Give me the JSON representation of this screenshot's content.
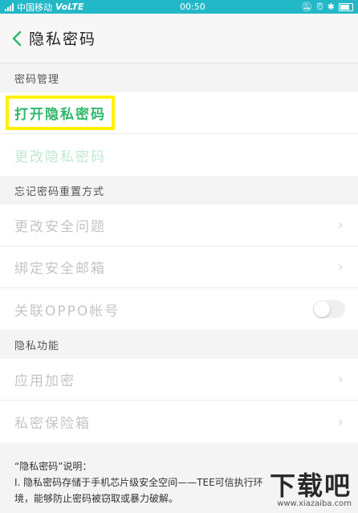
{
  "status_bar": {
    "carrier": "中国移动",
    "network": "VoLTE",
    "time": "00:50"
  },
  "header": {
    "title": "隐私密码"
  },
  "sections": [
    {
      "title": "密码管理",
      "items": [
        {
          "label": "打开隐私密码",
          "state": "active"
        },
        {
          "label": "更改隐私密码",
          "state": "disabled"
        }
      ]
    },
    {
      "title": "忘记密码重置方式",
      "items": [
        {
          "label": "更改安全问题"
        },
        {
          "label": "绑定安全邮箱"
        },
        {
          "label": "关联OPPO帐号"
        }
      ]
    },
    {
      "title": "隐私功能",
      "items": [
        {
          "label": "应用加密"
        },
        {
          "label": "私密保险箱"
        }
      ]
    }
  ],
  "notes": {
    "title": "“隐私密码”说明：",
    "line1": "Ⅰ. 隐私密码存储于手机芯片级安全空间——TEE可信执行环",
    "line2": "境，能够防止密码被窃取或暴力破解。"
  },
  "watermark": {
    "brand": "下载吧",
    "url": "www.xiazaiba.com"
  },
  "colors": {
    "status_bar": "#23b8c8",
    "accent_green": "#2fb86a",
    "highlight": "#fff200"
  }
}
